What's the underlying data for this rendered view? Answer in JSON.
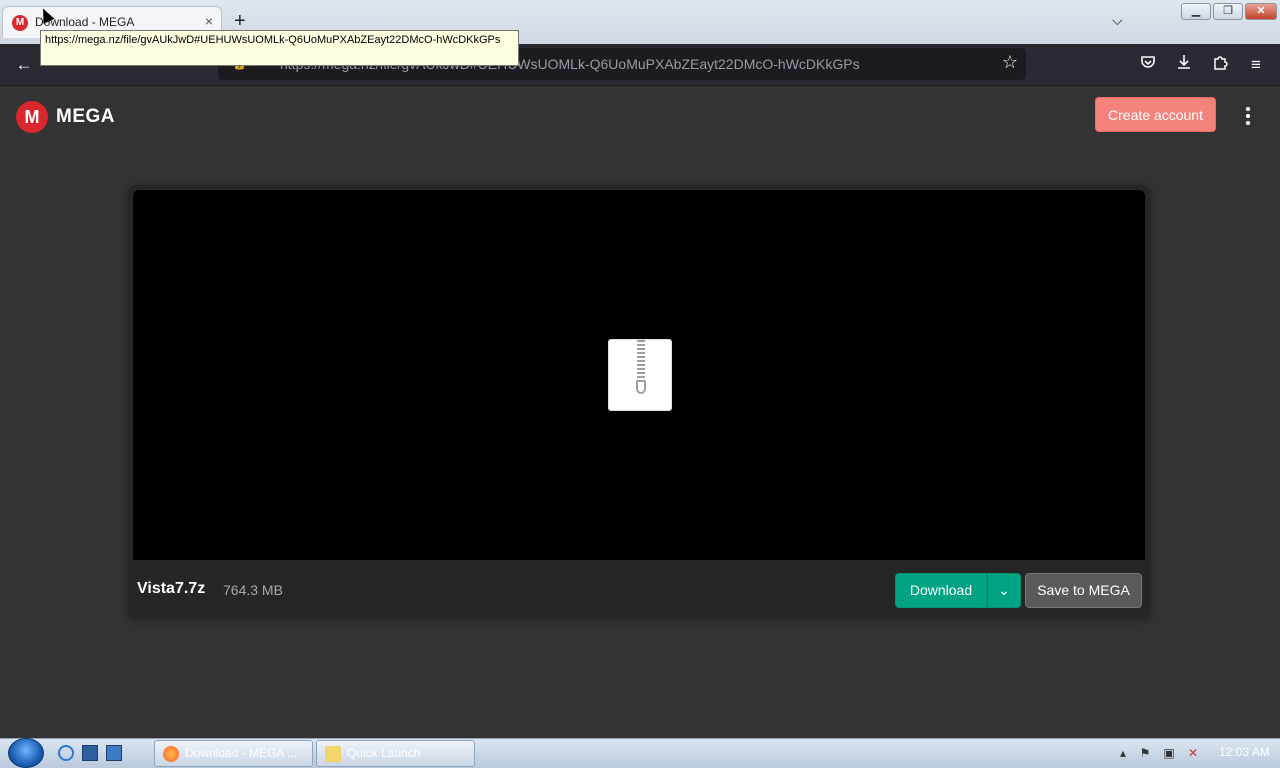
{
  "browser": {
    "tab_title": "Download - MEGA",
    "tab_close": "×",
    "new_tab": "+",
    "tab_list": "⌵",
    "tooltip": "https://mega.nz/file/gvAUkJwD#UEHUWsUOMLk-Q6UoMuPXAbZEayt22DMcO-hWcDKkGPs",
    "url": "https://mega.nz/file/gvAUkJwD#UEHUWsUOMLk-Q6UoMuPXAbZEayt22DMcO-hWcDKkGPs",
    "window_controls": {
      "minimize": "▁",
      "maximize": "❐",
      "close": "✕"
    }
  },
  "mega": {
    "logo_letter": "M",
    "brand": "MEGA",
    "create_account": "Create account"
  },
  "file": {
    "name": "Vista7.7z",
    "size": "764.3 MB"
  },
  "actions": {
    "download": "Download",
    "download_options": "⌄",
    "save": "Save to MEGA"
  },
  "taskbar": {
    "firefox_task": "Download - MEGA ...",
    "quick_launch": "Quick Launch",
    "clock": "12:03 AM"
  },
  "colors": {
    "mega_red": "#d9272e",
    "download_green": "#00a382",
    "create_account_pink": "#f6827c"
  }
}
